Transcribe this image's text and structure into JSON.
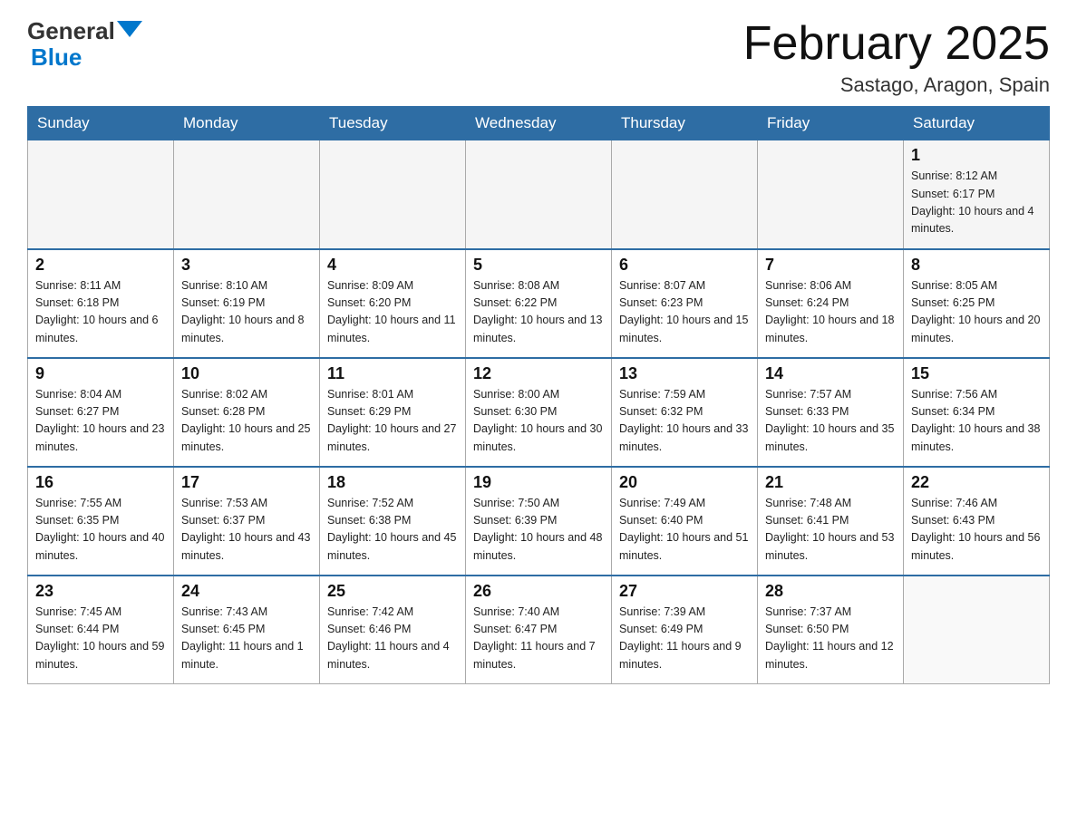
{
  "logo": {
    "general": "General",
    "blue": "Blue",
    "triangle_color": "#0077cc"
  },
  "header": {
    "month_year": "February 2025",
    "location": "Sastago, Aragon, Spain"
  },
  "weekdays": [
    "Sunday",
    "Monday",
    "Tuesday",
    "Wednesday",
    "Thursday",
    "Friday",
    "Saturday"
  ],
  "weeks": [
    [
      {
        "day": "",
        "info": ""
      },
      {
        "day": "",
        "info": ""
      },
      {
        "day": "",
        "info": ""
      },
      {
        "day": "",
        "info": ""
      },
      {
        "day": "",
        "info": ""
      },
      {
        "day": "",
        "info": ""
      },
      {
        "day": "1",
        "info": "Sunrise: 8:12 AM\nSunset: 6:17 PM\nDaylight: 10 hours and 4 minutes."
      }
    ],
    [
      {
        "day": "2",
        "info": "Sunrise: 8:11 AM\nSunset: 6:18 PM\nDaylight: 10 hours and 6 minutes."
      },
      {
        "day": "3",
        "info": "Sunrise: 8:10 AM\nSunset: 6:19 PM\nDaylight: 10 hours and 8 minutes."
      },
      {
        "day": "4",
        "info": "Sunrise: 8:09 AM\nSunset: 6:20 PM\nDaylight: 10 hours and 11 minutes."
      },
      {
        "day": "5",
        "info": "Sunrise: 8:08 AM\nSunset: 6:22 PM\nDaylight: 10 hours and 13 minutes."
      },
      {
        "day": "6",
        "info": "Sunrise: 8:07 AM\nSunset: 6:23 PM\nDaylight: 10 hours and 15 minutes."
      },
      {
        "day": "7",
        "info": "Sunrise: 8:06 AM\nSunset: 6:24 PM\nDaylight: 10 hours and 18 minutes."
      },
      {
        "day": "8",
        "info": "Sunrise: 8:05 AM\nSunset: 6:25 PM\nDaylight: 10 hours and 20 minutes."
      }
    ],
    [
      {
        "day": "9",
        "info": "Sunrise: 8:04 AM\nSunset: 6:27 PM\nDaylight: 10 hours and 23 minutes."
      },
      {
        "day": "10",
        "info": "Sunrise: 8:02 AM\nSunset: 6:28 PM\nDaylight: 10 hours and 25 minutes."
      },
      {
        "day": "11",
        "info": "Sunrise: 8:01 AM\nSunset: 6:29 PM\nDaylight: 10 hours and 27 minutes."
      },
      {
        "day": "12",
        "info": "Sunrise: 8:00 AM\nSunset: 6:30 PM\nDaylight: 10 hours and 30 minutes."
      },
      {
        "day": "13",
        "info": "Sunrise: 7:59 AM\nSunset: 6:32 PM\nDaylight: 10 hours and 33 minutes."
      },
      {
        "day": "14",
        "info": "Sunrise: 7:57 AM\nSunset: 6:33 PM\nDaylight: 10 hours and 35 minutes."
      },
      {
        "day": "15",
        "info": "Sunrise: 7:56 AM\nSunset: 6:34 PM\nDaylight: 10 hours and 38 minutes."
      }
    ],
    [
      {
        "day": "16",
        "info": "Sunrise: 7:55 AM\nSunset: 6:35 PM\nDaylight: 10 hours and 40 minutes."
      },
      {
        "day": "17",
        "info": "Sunrise: 7:53 AM\nSunset: 6:37 PM\nDaylight: 10 hours and 43 minutes."
      },
      {
        "day": "18",
        "info": "Sunrise: 7:52 AM\nSunset: 6:38 PM\nDaylight: 10 hours and 45 minutes."
      },
      {
        "day": "19",
        "info": "Sunrise: 7:50 AM\nSunset: 6:39 PM\nDaylight: 10 hours and 48 minutes."
      },
      {
        "day": "20",
        "info": "Sunrise: 7:49 AM\nSunset: 6:40 PM\nDaylight: 10 hours and 51 minutes."
      },
      {
        "day": "21",
        "info": "Sunrise: 7:48 AM\nSunset: 6:41 PM\nDaylight: 10 hours and 53 minutes."
      },
      {
        "day": "22",
        "info": "Sunrise: 7:46 AM\nSunset: 6:43 PM\nDaylight: 10 hours and 56 minutes."
      }
    ],
    [
      {
        "day": "23",
        "info": "Sunrise: 7:45 AM\nSunset: 6:44 PM\nDaylight: 10 hours and 59 minutes."
      },
      {
        "day": "24",
        "info": "Sunrise: 7:43 AM\nSunset: 6:45 PM\nDaylight: 11 hours and 1 minute."
      },
      {
        "day": "25",
        "info": "Sunrise: 7:42 AM\nSunset: 6:46 PM\nDaylight: 11 hours and 4 minutes."
      },
      {
        "day": "26",
        "info": "Sunrise: 7:40 AM\nSunset: 6:47 PM\nDaylight: 11 hours and 7 minutes."
      },
      {
        "day": "27",
        "info": "Sunrise: 7:39 AM\nSunset: 6:49 PM\nDaylight: 11 hours and 9 minutes."
      },
      {
        "day": "28",
        "info": "Sunrise: 7:37 AM\nSunset: 6:50 PM\nDaylight: 11 hours and 12 minutes."
      },
      {
        "day": "",
        "info": ""
      }
    ]
  ]
}
